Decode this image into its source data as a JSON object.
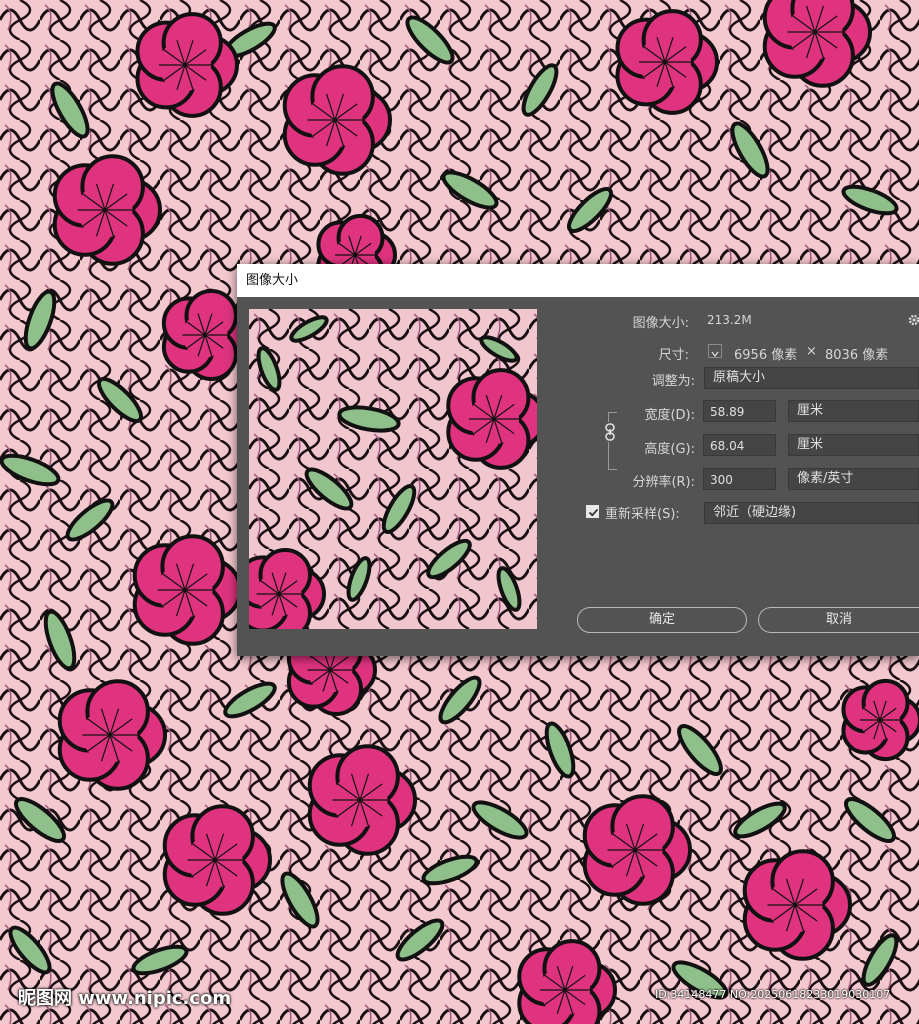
{
  "colors": {
    "background_pink": "#d9a2ba",
    "flower": "#e0337f",
    "leaf": "#8fbf8a",
    "outline": "#111111",
    "dialog": "#535353"
  },
  "dialog": {
    "title": "图像大小",
    "image_size_label": "图像大小:",
    "image_size_value": "213.2M",
    "settings_icon": "gear-icon",
    "dimensions_label": "尺寸:",
    "dimensions_width": "6956 像素",
    "dimensions_times": "×",
    "dimensions_height": "8036 像素",
    "fit_to_label": "调整为:",
    "fit_to_value": "原稿大小",
    "width_label": "宽度(D):",
    "width_value": "58.89",
    "width_unit": "厘米",
    "height_label": "高度(G):",
    "height_value": "68.04",
    "height_unit": "厘米",
    "resolution_label": "分辨率(R):",
    "resolution_value": "300",
    "resolution_unit": "像素/英寸",
    "resample_label": "重新采样(S):",
    "resample_checked": true,
    "resample_value": "邻近（硬边缘)",
    "ok_label": "确定",
    "cancel_label": "取消"
  },
  "watermark": {
    "left": "昵图网 www.nipic.com",
    "right": "ID:34148477 NO:20250618233019030107"
  }
}
